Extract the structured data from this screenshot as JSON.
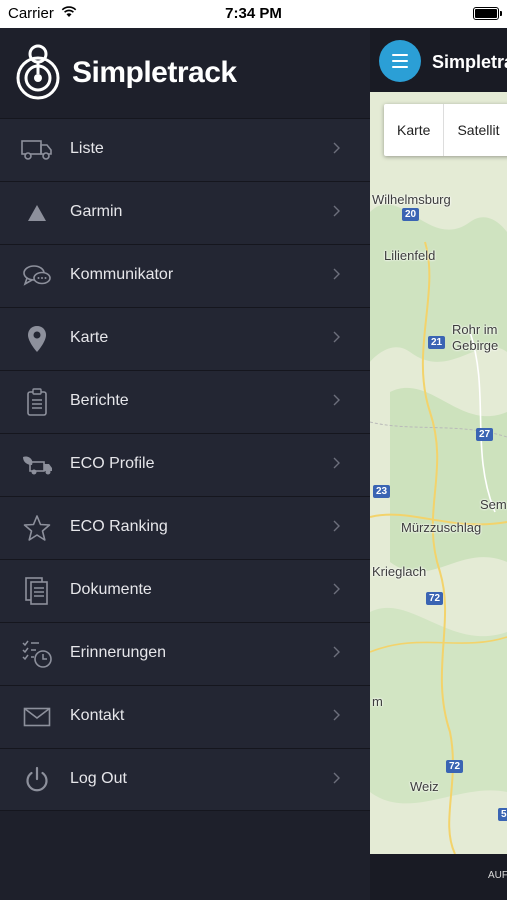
{
  "status_bar": {
    "carrier": "Carrier",
    "time": "7:34 PM",
    "battery_level": 1.0
  },
  "brand": {
    "name": "Simpletrack"
  },
  "menu": [
    {
      "label": "Liste",
      "icon": "truck-icon"
    },
    {
      "label": "Garmin",
      "icon": "triangle-icon"
    },
    {
      "label": "Kommunikator",
      "icon": "chat-bubbles-icon"
    },
    {
      "label": "Karte",
      "icon": "map-pin-icon"
    },
    {
      "label": "Berichte",
      "icon": "clipboard-icon"
    },
    {
      "label": "ECO Profile",
      "icon": "eco-truck-icon"
    },
    {
      "label": "ECO Ranking",
      "icon": "star-icon"
    },
    {
      "label": "Dokumente",
      "icon": "documents-icon"
    },
    {
      "label": "Erinnerungen",
      "icon": "reminder-clock-icon"
    },
    {
      "label": "Kontakt",
      "icon": "envelope-icon"
    },
    {
      "label": "Log Out",
      "icon": "power-icon"
    }
  ],
  "map_panel": {
    "title": "Simpletra",
    "map_types": [
      "Karte",
      "Satellit"
    ],
    "places": [
      "Wilhelmsburg",
      "Lilienfeld",
      "Rohr im",
      "Gebirge",
      "Sem",
      "Mürzzuschlag",
      "Krieglach",
      "m",
      "Weiz"
    ],
    "roads": [
      "20",
      "21",
      "27",
      "23",
      "72",
      "72",
      "5"
    ],
    "footer_text": "AUF"
  },
  "colors": {
    "accent": "#2b9fd6",
    "drawer_bg": "#1e202b",
    "item_bg": "#232633"
  }
}
